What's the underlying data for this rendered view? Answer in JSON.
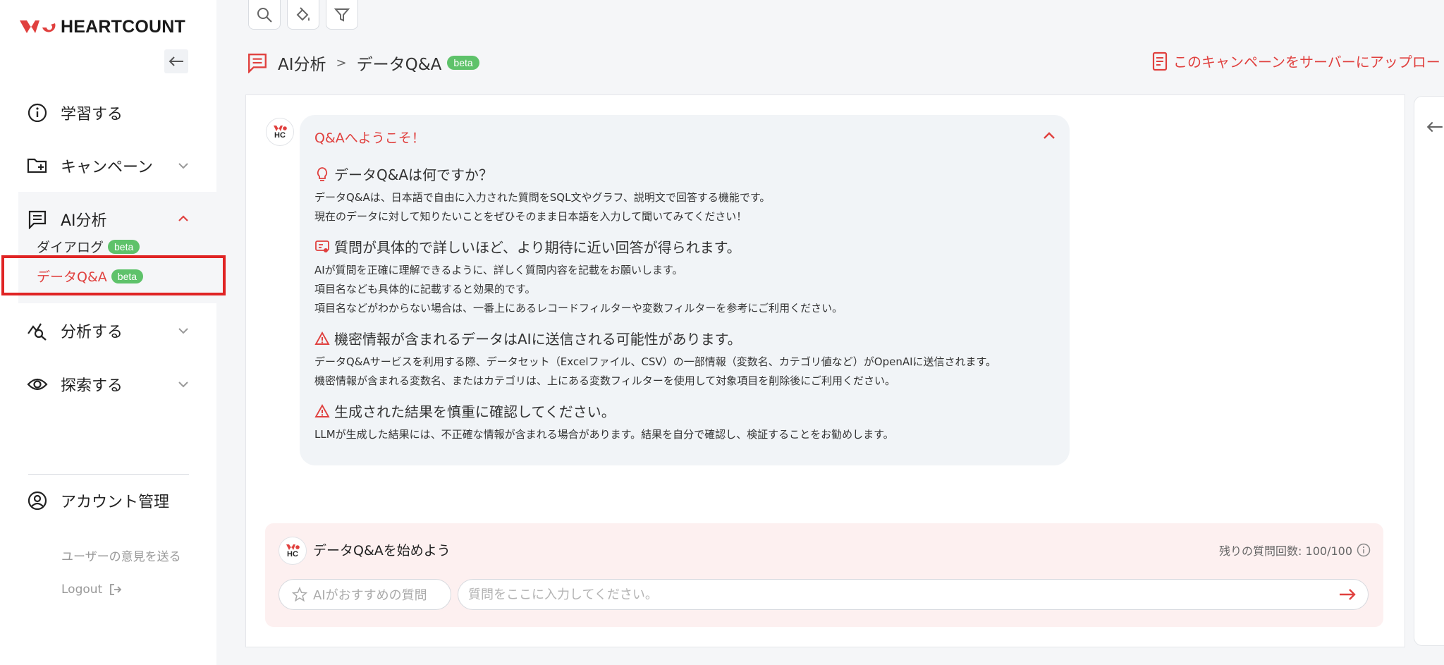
{
  "brand": {
    "name": "HEARTCOUNT",
    "accent": "#e0403e",
    "beta_color": "#5ec26a"
  },
  "sidebar": {
    "items": [
      {
        "label": "学習する",
        "icon": "info-icon"
      },
      {
        "label": "キャンペーン",
        "icon": "folder-plus-icon"
      },
      {
        "label": "AI分析",
        "icon": "chat-icon"
      },
      {
        "label": "分析する",
        "icon": "analytics-icon"
      },
      {
        "label": "探索する",
        "icon": "eye-icon"
      }
    ],
    "ai_sub": [
      {
        "label": "ダイアログ",
        "badge": "beta"
      },
      {
        "label": "データQ&A",
        "badge": "beta"
      }
    ],
    "account": "アカウント管理",
    "feedback": "ユーザーの意見を送る",
    "logout": "Logout"
  },
  "breadcrumb": {
    "parent": "AI分析",
    "separator": ">",
    "current": "データQ&A",
    "badge": "beta"
  },
  "upload_label": "このキャンペーンをサーバーにアップロード",
  "welcome": {
    "title": "Q&Aへようこそ！",
    "sections": [
      {
        "icon": "lightbulb-icon",
        "heading": "データQ&Aは何ですか？",
        "lines": [
          "データQ&Aは、日本語で自由に入力された質問をSQL文やグラフ、説明文で回答する機能です。",
          "現在のデータに対して知りたいことをぜひそのまま日本語を入力して聞いてみてください！"
        ]
      },
      {
        "icon": "chat-detail-icon",
        "heading": "質問が具体的で詳しいほど、より期待に近い回答が得られます。",
        "lines": [
          "AIが質問を正確に理解できるように、詳しく質問内容を記載をお願いします。",
          "項目名なども具体的に記載すると効果的です。",
          "項目名などがわからない場合は、一番上にあるレコードフィルターや変数フィルターを参考にご利用ください。"
        ]
      },
      {
        "icon": "warning-icon",
        "heading": "機密情報が含まれるデータはAIに送信される可能性があります。",
        "lines": [
          "データQ&Aサービスを利用する際、データセット（Excelファイル、CSV）の一部情報（変数名、カテゴリ値など）がOpenAIに送信されます。",
          "機密情報が含まれる変数名、またはカテゴリは、上にある変数フィルターを使用して対象項目を削除後にご利用ください。"
        ]
      },
      {
        "icon": "warning-icon",
        "heading": "生成された結果を慎重に確認してください。",
        "lines": [
          "LLMが生成した結果には、不正確な情報が含まれる場合があります。結果を自分で確認し、検証することをお勧めします。"
        ]
      }
    ]
  },
  "qa_input": {
    "title": "データQ&Aを始めよう",
    "remaining_label": "残りの質問回数: 100/100",
    "suggest_label": "AIがおすすめの質問",
    "placeholder": "質問をここに入力してください。"
  }
}
